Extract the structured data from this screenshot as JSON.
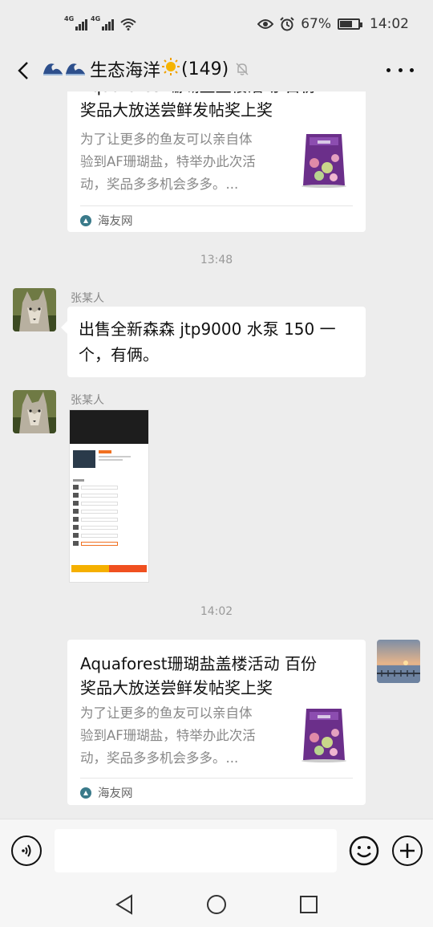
{
  "status_bar": {
    "sim1": "4G",
    "sim2": "4G",
    "battery_percent": "67%",
    "battery_level": 0.67,
    "time": "14:02"
  },
  "header": {
    "group_name": "生态海洋",
    "member_count": "(149)",
    "icons": [
      "back-arrow-icon",
      "wave-emoji",
      "sun-emoji",
      "mute-bell-icon",
      "more-icon"
    ]
  },
  "messages": {
    "top_card": {
      "title_partial": "Aquaforest珊瑚盐盖楼活动 百份",
      "title_line2": "奖品大放送尝鲜发帖奖上奖",
      "desc_line1": "为了让更多的鱼友可以亲自体",
      "desc_line2": "验到AF珊瑚盐，特举办此次活",
      "desc_line3": "动，奖品多多机会多多。...",
      "source": "海友网"
    },
    "time1": "13:48",
    "msg1": {
      "sender": "张某人",
      "line1": "出售全新森森 jtp9000 水泵 150 一",
      "line2": "个，有俩。"
    },
    "msg2": {
      "sender": "张某人",
      "image": "screenshot-thumbnail"
    },
    "time2": "14:02",
    "bottom_card": {
      "title_line1": "Aquaforest珊瑚盐盖楼活动 百份",
      "title_line2": "奖品大放送尝鲜发帖奖上奖",
      "desc_line1": "为了让更多的鱼友可以亲自体",
      "desc_line2": "验到AF珊瑚盐，特举办此次活",
      "desc_line3": "动，奖品多多机会多多。...",
      "source": "海友网"
    }
  },
  "input_bar": {
    "value": "",
    "icons": [
      "voice-icon",
      "emoji-icon",
      "plus-icon"
    ]
  },
  "colors": {
    "background": "#ededed",
    "bubble": "#ffffff",
    "muted_text": "#888888"
  }
}
